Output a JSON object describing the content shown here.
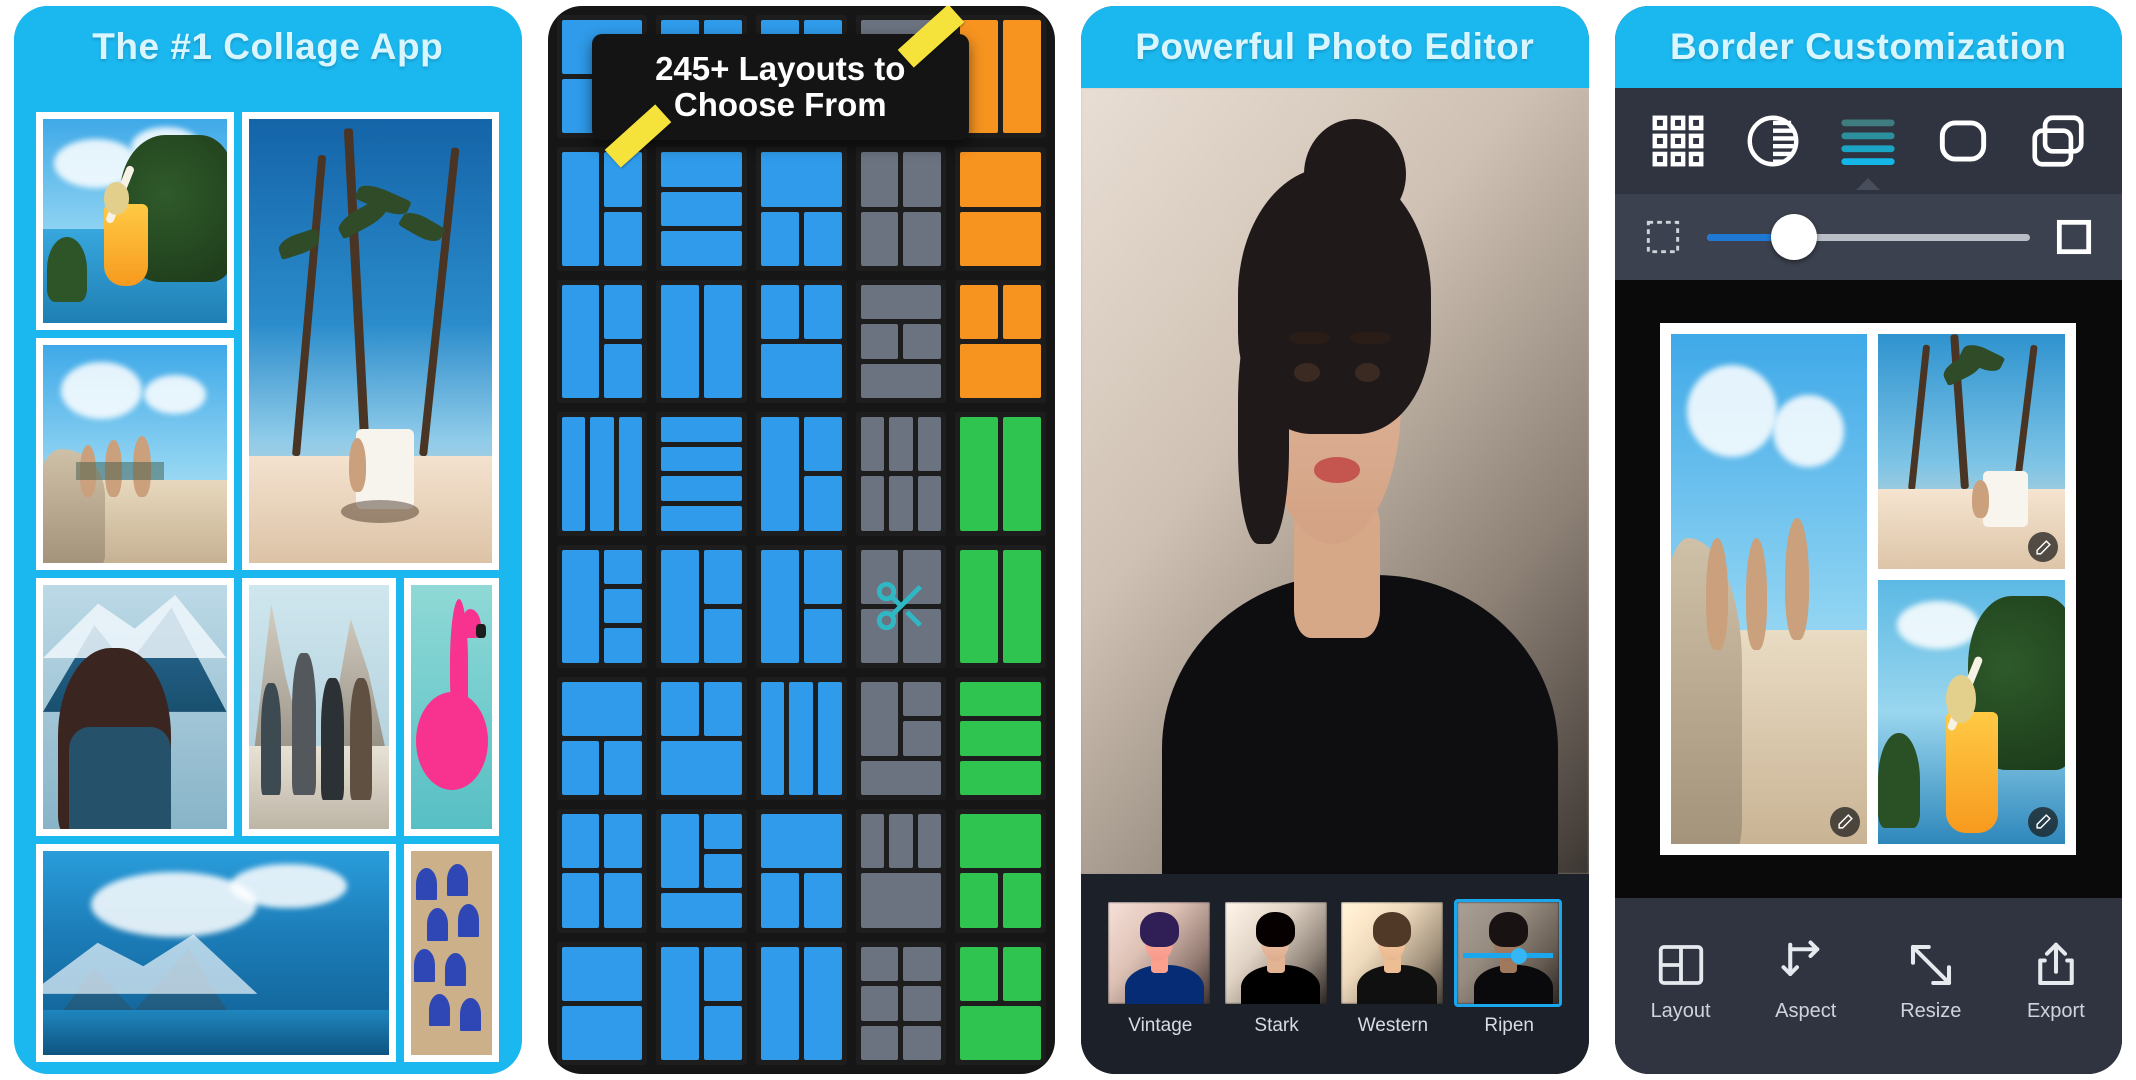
{
  "panels": [
    {
      "id": "collage-app",
      "header": "The #1 Collage App",
      "accent": "#1BB8F0"
    },
    {
      "id": "layouts",
      "banner_line1": "245+ Layouts to",
      "banner_line2": "Choose From",
      "scissors_icon": "scissors-icon",
      "tape_icon": "tape-icon"
    },
    {
      "id": "photo-editor",
      "header": "Powerful Photo Editor",
      "filters": [
        {
          "label": "Vintage",
          "selected": false
        },
        {
          "label": "Stark",
          "selected": false
        },
        {
          "label": "Western",
          "selected": false
        },
        {
          "label": "Ripen",
          "selected": true
        }
      ]
    },
    {
      "id": "border-customization",
      "header": "Border Customization",
      "top_tools": [
        {
          "name": "grid-pattern-icon",
          "selected": false
        },
        {
          "name": "contrast-icon",
          "selected": false
        },
        {
          "name": "border-lines-icon",
          "selected": true
        },
        {
          "name": "rounded-corner-icon",
          "selected": false
        },
        {
          "name": "layers-icon",
          "selected": false
        }
      ],
      "slider": {
        "min_icon": "dashed-square-icon",
        "max_icon": "solid-square-icon",
        "value": 27
      },
      "bottom_tools": [
        {
          "label": "Layout",
          "icon": "layout-grid-icon"
        },
        {
          "label": "Aspect",
          "icon": "aspect-arrow-icon"
        },
        {
          "label": "Resize",
          "icon": "resize-diagonal-icon"
        },
        {
          "label": "Export",
          "icon": "share-export-icon"
        }
      ],
      "edit_badge_icon": "edit-pencil-icon"
    }
  ],
  "colors": {
    "accent_blue": "#1BB8F0",
    "header_text": "#d9f6ff",
    "layout_blue": "#2f9bea",
    "layout_gray": "#6b7280",
    "layout_green": "#2fc34f",
    "layout_orange": "#f79420",
    "tape_yellow": "#f5e33c",
    "scissors_teal": "#2fb8c4",
    "toolbar_dark": "#2f3440",
    "slider_fill": "#1f78d1",
    "selected_border": "#1aa7ee"
  }
}
